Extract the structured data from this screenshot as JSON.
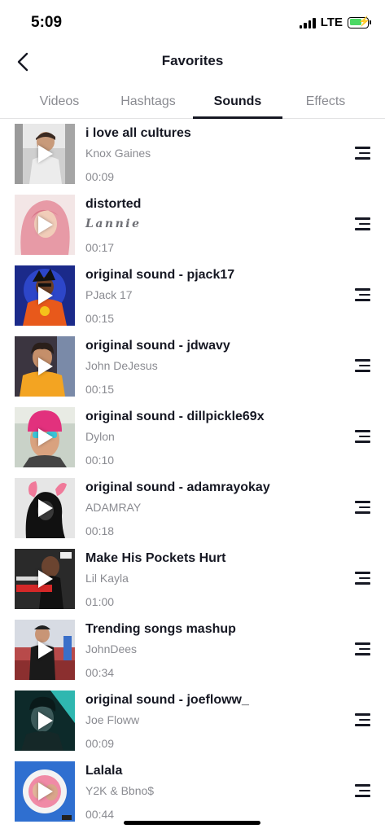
{
  "status_bar": {
    "time": "5:09",
    "network": "LTE",
    "battery_color": "#4cd964"
  },
  "header": {
    "back_icon": "chevron-left-icon",
    "title": "Favorites"
  },
  "tabs": [
    {
      "label": "Videos",
      "active": false
    },
    {
      "label": "Hashtags",
      "active": false
    },
    {
      "label": "Sounds",
      "active": true
    },
    {
      "label": "Effects",
      "active": false
    }
  ],
  "sounds": [
    {
      "title": "i love all cultures",
      "artist": "Knox Gaines",
      "duration": "00:09"
    },
    {
      "title": "distorted",
      "artist": "Lannie",
      "duration": "00:17"
    },
    {
      "title": "original sound - pjack17",
      "artist": "PJack 17",
      "duration": "00:15"
    },
    {
      "title": "original sound - jdwavy",
      "artist": "John DeJesus",
      "duration": "00:15"
    },
    {
      "title": "original sound - dillpickle69x",
      "artist": "Dylon",
      "duration": "00:10"
    },
    {
      "title": "original sound - adamrayokay",
      "artist": "ADAMRAY",
      "duration": "00:18"
    },
    {
      "title": "Make His Pockets Hurt",
      "artist": "Lil Kayla",
      "duration": "01:00"
    },
    {
      "title": "Trending songs mashup",
      "artist": "JohnDees",
      "duration": "00:34"
    },
    {
      "title": "original sound - joefloww_",
      "artist": "Joe Floww",
      "duration": "00:09"
    },
    {
      "title": "Lalala",
      "artist": "Y2K & Bbno$",
      "duration": "00:44"
    }
  ],
  "icons": {
    "play": "play-icon",
    "item_menu": "reorder-icon"
  },
  "colors": {
    "text_primary": "#161823",
    "text_secondary": "#8a8b91",
    "divider": "#e3e3e4"
  }
}
